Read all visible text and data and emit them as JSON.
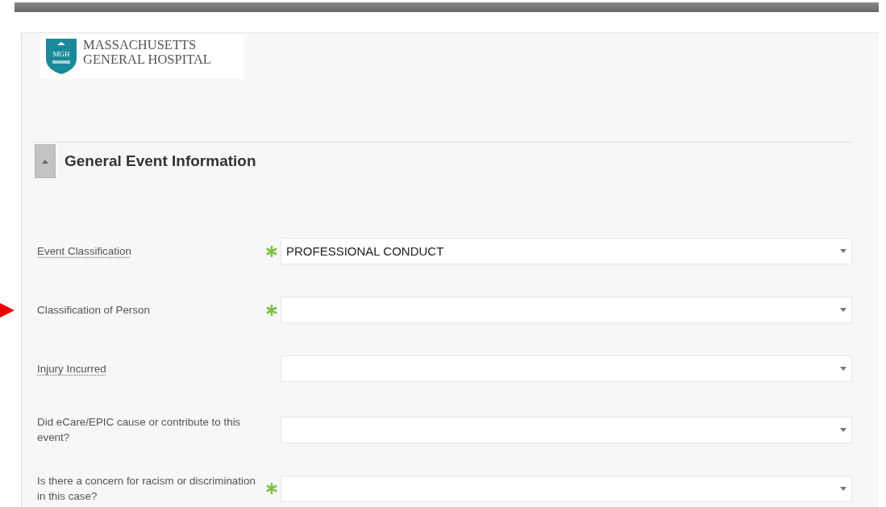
{
  "logo": {
    "line_1": "MASSACHUSETTS",
    "line_2": "GENERAL HOSPITAL",
    "badge": "MGH"
  },
  "section": {
    "title": "General Event Information",
    "expanded": true
  },
  "fields": [
    {
      "label": "Event Classification",
      "help": true,
      "required": true,
      "value": "PROFESSIONAL CONDUCT",
      "marked": false
    },
    {
      "label": "Classification of Person",
      "help": false,
      "required": true,
      "marked": true
    },
    {
      "label": "Injury Incurred",
      "help": true,
      "required": false,
      "marked": false
    },
    {
      "label": "Did eCare/EPIC cause or contribute to this event?",
      "help": false,
      "required": false,
      "marked": false
    },
    {
      "label": "Is there a concern for racism or discrimination in this case?",
      "help": false,
      "required": true,
      "marked": false
    }
  ]
}
